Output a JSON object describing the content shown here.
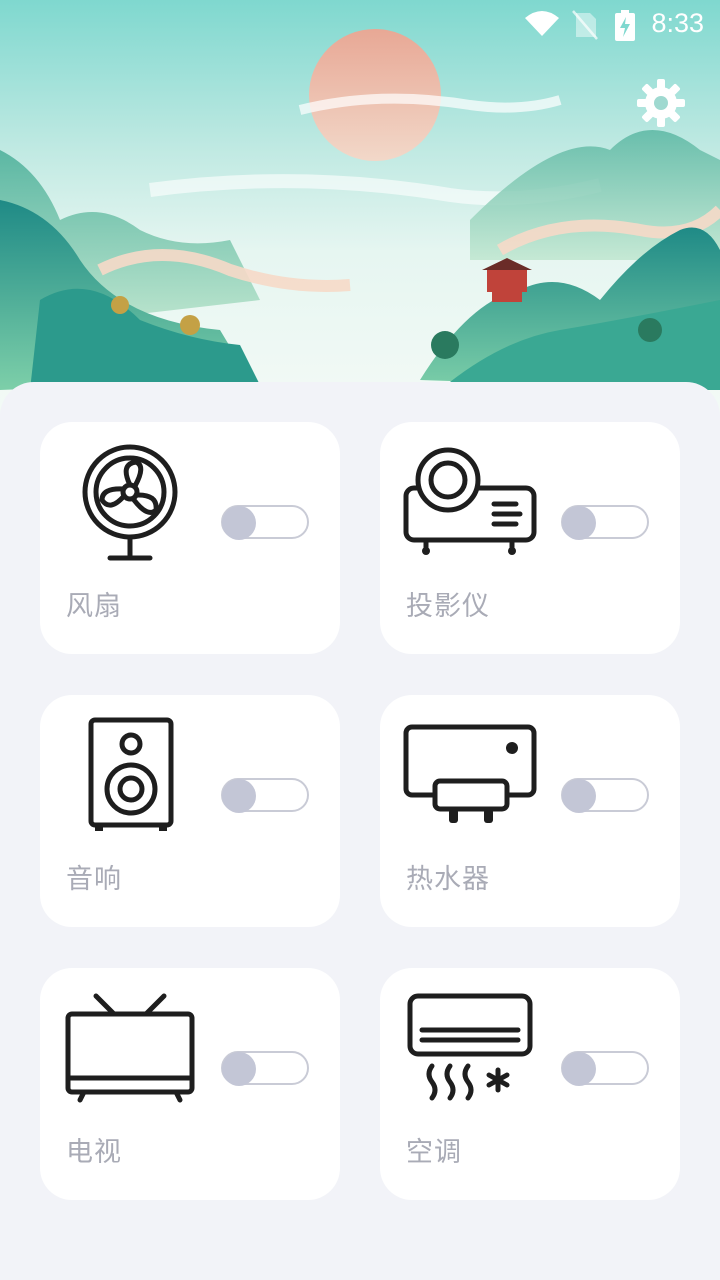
{
  "status_bar": {
    "time": "8:33",
    "icons": [
      "wifi-icon",
      "no-sim-icon",
      "battery-charging-icon"
    ]
  },
  "header": {
    "settings_icon": "gear-icon"
  },
  "devices": [
    {
      "label": "风扇",
      "icon": "fan-icon",
      "on": false
    },
    {
      "label": "投影仪",
      "icon": "projector-icon",
      "on": false
    },
    {
      "label": "音响",
      "icon": "speaker-icon",
      "on": false
    },
    {
      "label": "热水器",
      "icon": "water-heater-icon",
      "on": false
    },
    {
      "label": "电视",
      "icon": "tv-icon",
      "on": false
    },
    {
      "label": "空调",
      "icon": "air-conditioner-icon",
      "on": false
    }
  ],
  "colors": {
    "accent": "#c3c6d6",
    "label": "#a9abb6",
    "background": "#f2f3f8",
    "header": "#7fd8cf"
  }
}
